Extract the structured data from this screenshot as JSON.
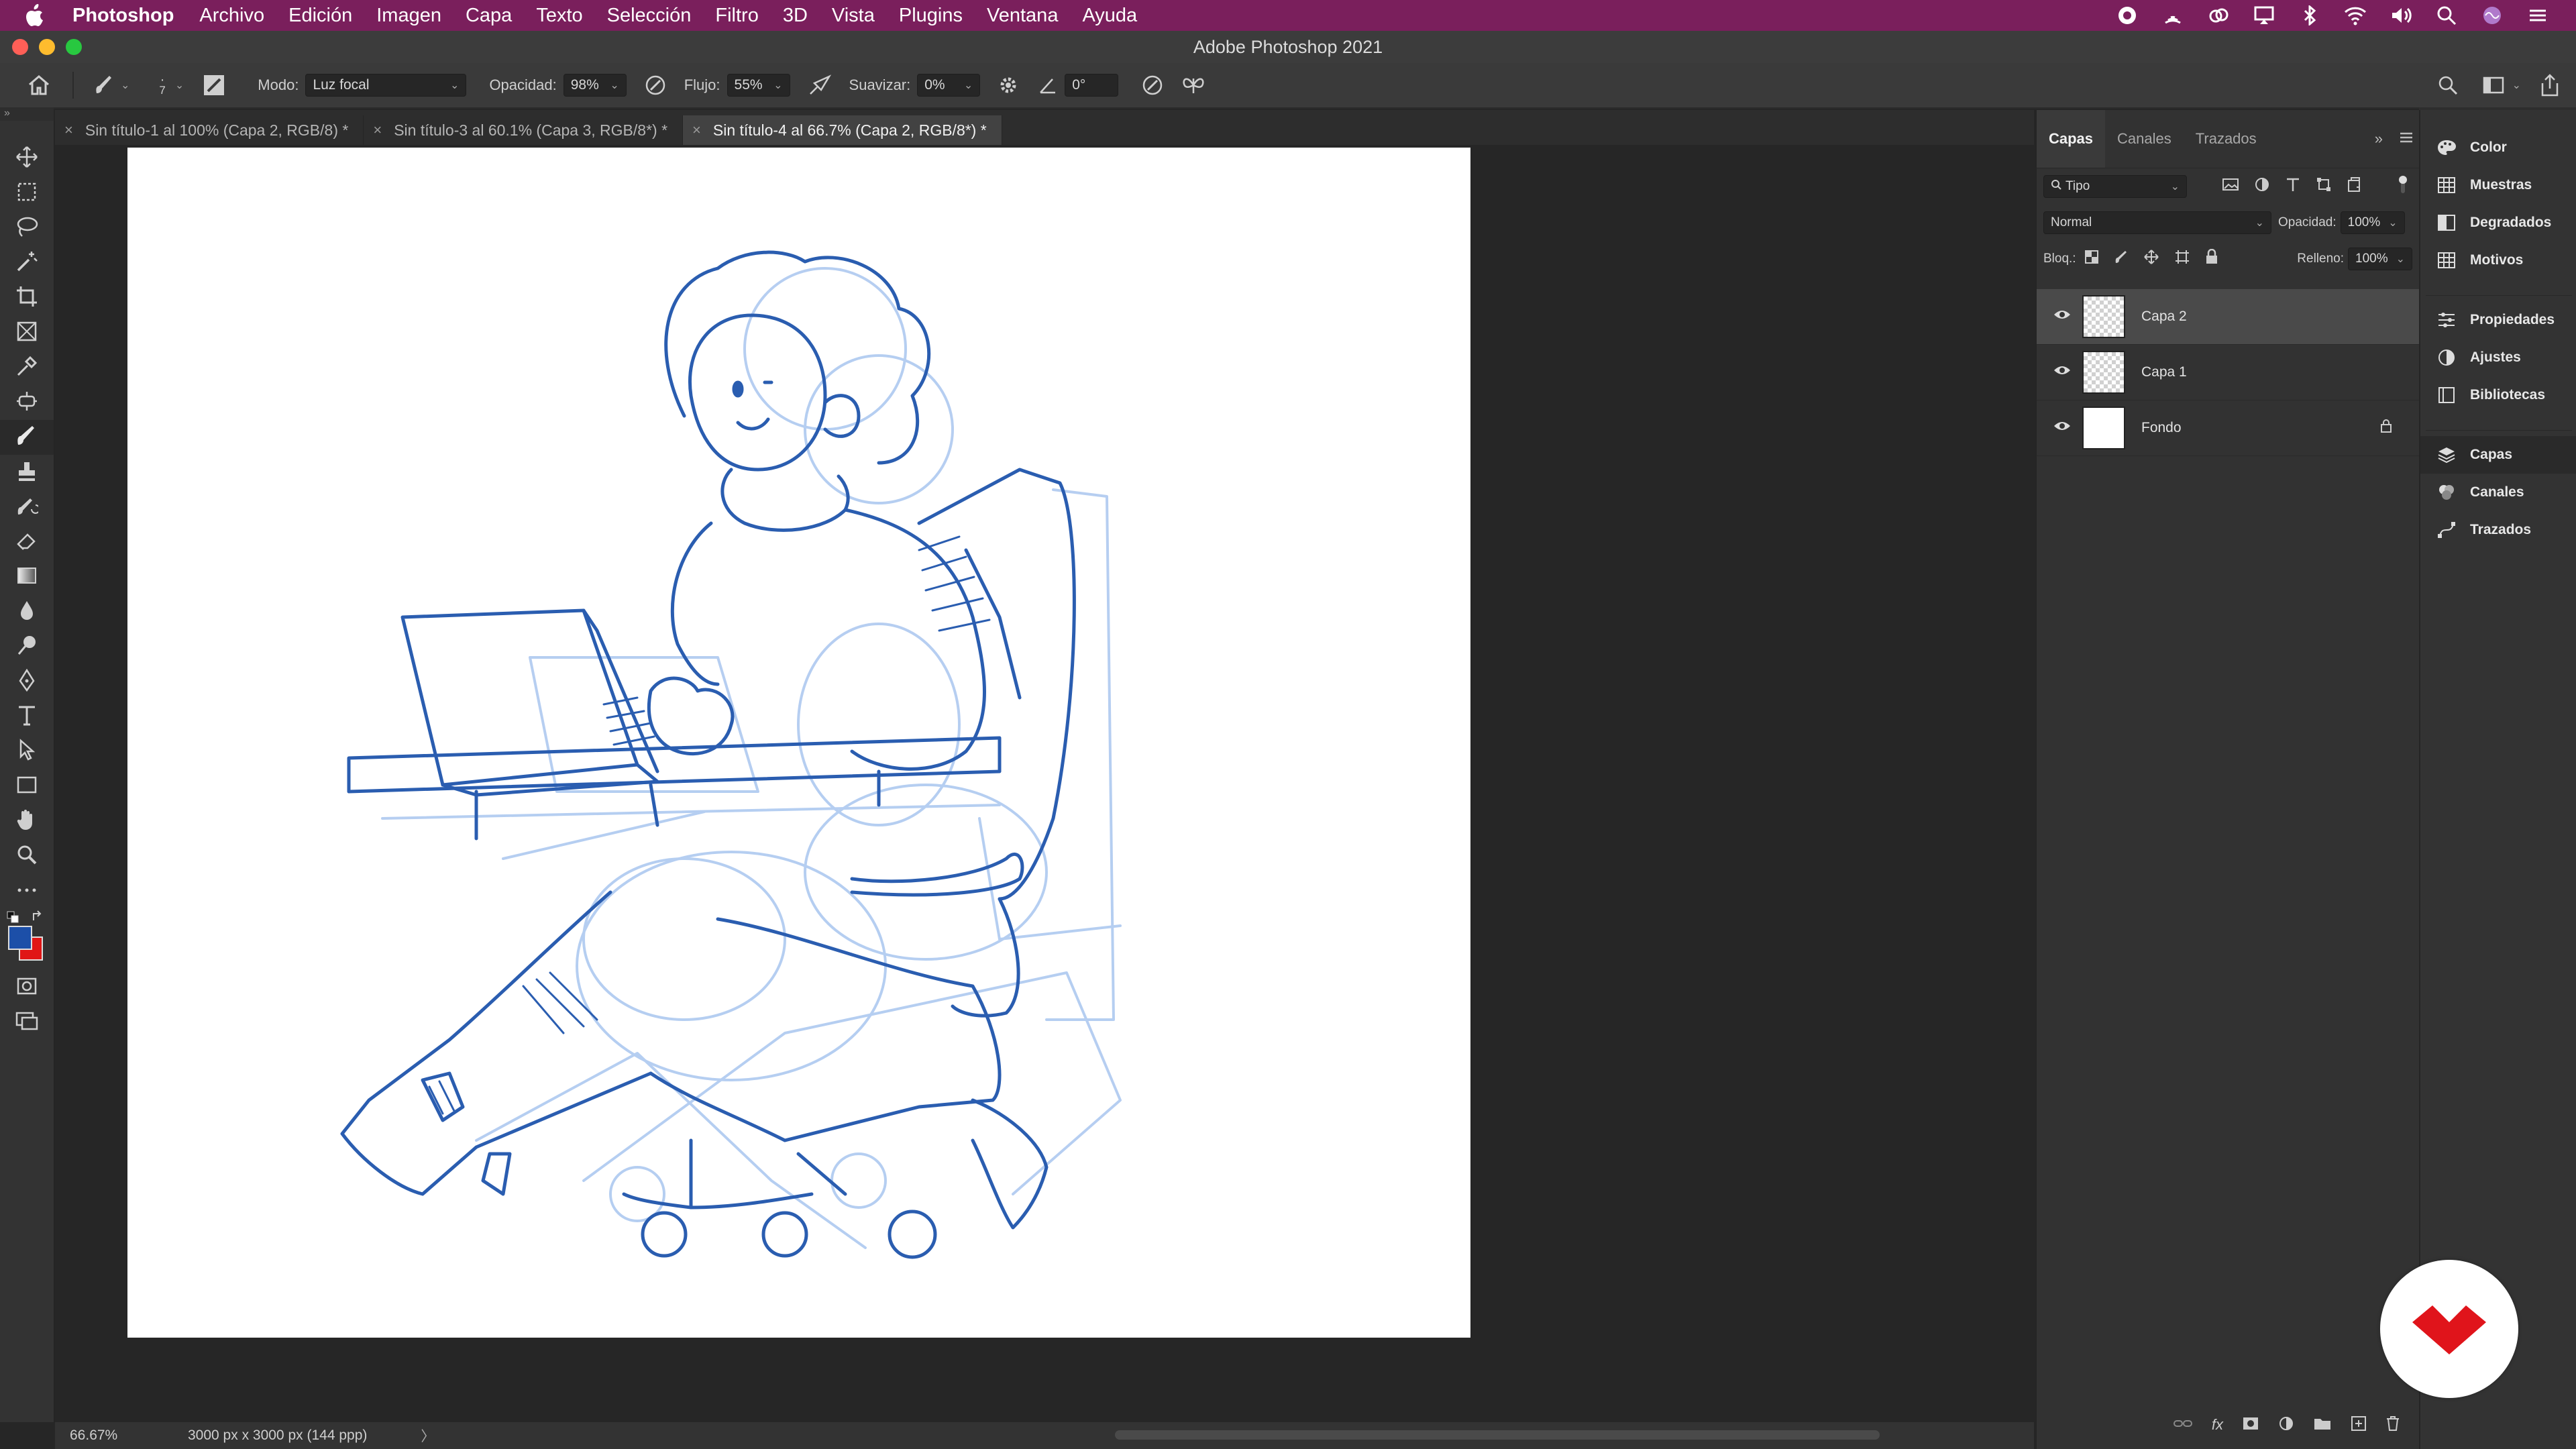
{
  "menubar": {
    "app_name": "Photoshop",
    "items": [
      "Archivo",
      "Edición",
      "Imagen",
      "Capa",
      "Texto",
      "Selección",
      "Filtro",
      "3D",
      "Vista",
      "Plugins",
      "Ventana",
      "Ayuda"
    ]
  },
  "window": {
    "title": "Adobe Photoshop 2021"
  },
  "options": {
    "brush_size": "7",
    "mode_label": "Modo:",
    "mode_value": "Luz focal",
    "opacity_label": "Opacidad:",
    "opacity_value": "98%",
    "flow_label": "Flujo:",
    "flow_value": "55%",
    "smooth_label": "Suavizar:",
    "smooth_value": "0%",
    "angle_value": "0°"
  },
  "tabs": [
    {
      "label": "Sin título-1 al 100% (Capa 2, RGB/8) *"
    },
    {
      "label": "Sin título-3 al 60.1% (Capa 3, RGB/8*) *"
    },
    {
      "label": "Sin título-4 al 66.7% (Capa 2, RGB/8*) *"
    }
  ],
  "status": {
    "zoom": "66.67%",
    "doc_info": "3000 px x 3000 px (144 ppp)",
    "arrow": "〉"
  },
  "layers_panel": {
    "tabs": [
      "Capas",
      "Canales",
      "Trazados"
    ],
    "filter_label": "Tipo",
    "blend_mode": "Normal",
    "opacity_label": "Opacidad:",
    "opacity_value": "100%",
    "lock_label": "Bloq.:",
    "fill_label": "Relleno:",
    "fill_value": "100%",
    "layers": [
      {
        "name": "Capa 2",
        "active": true
      },
      {
        "name": "Capa 1",
        "active": false
      },
      {
        "name": "Fondo",
        "active": false,
        "locked": true
      }
    ]
  },
  "dock": {
    "group1": [
      "Color",
      "Muestras",
      "Degradados",
      "Motivos"
    ],
    "group2": [
      "Propiedades",
      "Ajustes",
      "Bibliotecas"
    ],
    "group3": [
      "Capas",
      "Canales",
      "Trazados"
    ]
  },
  "colors": {
    "foreground": "#1c4fa8",
    "background": "#e01616",
    "accent": "#7a1f5c",
    "sketch": "#2a5db0"
  }
}
